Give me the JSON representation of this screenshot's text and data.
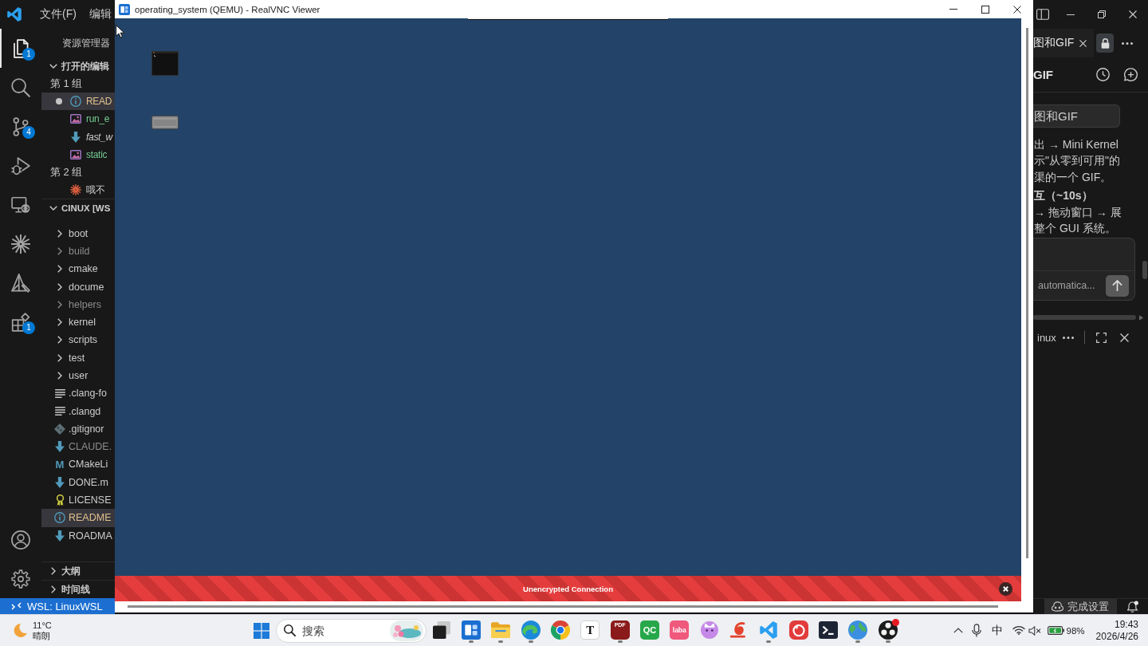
{
  "vscode": {
    "menu": [
      {
        "label": "文件(F)"
      },
      {
        "label": "编辑"
      }
    ],
    "activity_bar": [
      {
        "selected": true,
        "badge": "1"
      },
      {
        "selected": false
      },
      {
        "selected": false,
        "badge": "4"
      },
      {
        "selected": false
      },
      {
        "selected": false
      },
      {
        "selected": false
      },
      {
        "selected": false
      },
      {
        "selected": false,
        "badge": "1"
      }
    ],
    "explorer": {
      "title": "资源管理器",
      "open_editors": {
        "title": "打开的编辑",
        "expanded": true,
        "groups": [
          {
            "label": "第 1 组",
            "items": [
              {
                "label": "READ",
                "kind": "readme",
                "color": "#e2c08d",
                "selected": true,
                "dirty": true,
                "preview": false
              },
              {
                "label": "run_e",
                "kind": "image",
                "color": "#73c991",
                "selected": false,
                "dirty": false,
                "preview": false
              },
              {
                "label": "fast_w",
                "kind": "markdown",
                "color": "#cccccc",
                "selected": false,
                "dirty": false,
                "preview": true
              },
              {
                "label": "static",
                "kind": "image",
                "color": "#73c991",
                "selected": false,
                "dirty": false,
                "preview": false
              }
            ]
          },
          {
            "label": "第 2 组",
            "items": [
              {
                "label": "哦不",
                "kind": "chat",
                "color": "#cccccc",
                "selected": false,
                "dirty": false,
                "preview": false
              }
            ]
          }
        ]
      },
      "workspace": {
        "title": "CINUX [WS",
        "expanded": true,
        "items": [
          {
            "label": "boot",
            "kind": "folder",
            "expanded": false,
            "color": "#cccccc",
            "selected": false
          },
          {
            "label": "build",
            "kind": "folder",
            "expanded": false,
            "color": "#8c8c8c",
            "selected": false
          },
          {
            "label": "cmake",
            "kind": "folder",
            "expanded": false,
            "color": "#cccccc",
            "selected": false
          },
          {
            "label": "docume",
            "kind": "folder",
            "expanded": false,
            "color": "#cccccc",
            "selected": false
          },
          {
            "label": "helpers",
            "kind": "folder",
            "expanded": false,
            "color": "#8c8c8c",
            "selected": false
          },
          {
            "label": "kernel",
            "kind": "folder",
            "expanded": false,
            "color": "#cccccc",
            "selected": false
          },
          {
            "label": "scripts",
            "kind": "folder",
            "expanded": false,
            "color": "#cccccc",
            "selected": false
          },
          {
            "label": "test",
            "kind": "folder",
            "expanded": false,
            "color": "#cccccc",
            "selected": false
          },
          {
            "label": "user",
            "kind": "folder",
            "expanded": false,
            "color": "#cccccc",
            "selected": false
          },
          {
            "label": ".clang-fo",
            "kind": "config",
            "color": "#cccccc",
            "selected": false
          },
          {
            "label": ".clangd",
            "kind": "config",
            "color": "#cccccc",
            "selected": false
          },
          {
            "label": ".gitignor",
            "kind": "git",
            "color": "#cccccc",
            "selected": false
          },
          {
            "label": "CLAUDE.",
            "kind": "markdown",
            "color": "#8c8c8c",
            "selected": false
          },
          {
            "label": "CMakeLi",
            "kind": "cmake",
            "icon_char": "M",
            "color": "#cccccc",
            "selected": false
          },
          {
            "label": "DONE.m",
            "kind": "markdown",
            "color": "#cccccc",
            "selected": false
          },
          {
            "label": "LICENSE",
            "kind": "license",
            "color": "#cccccc",
            "selected": false
          },
          {
            "label": "README",
            "kind": "readme",
            "color": "#e2c08d",
            "selected": true
          },
          {
            "label": "ROADMA",
            "kind": "markdown",
            "color": "#cccccc",
            "selected": false
          }
        ]
      },
      "sections": [
        {
          "title": "大纲",
          "expanded": false
        },
        {
          "title": "时间线",
          "expanded": false
        }
      ]
    },
    "assistant": {
      "tab": {
        "label": "图和GIF",
        "selected": true
      },
      "title": "GIF",
      "user_message": "图和GIF",
      "lines": [
        {
          "text": "出 → Mini Kernel",
          "bold": false
        },
        {
          "text": "示\"从零到可用\"的",
          "bold": false
        },
        {
          "text": "渠的一个 GIF。",
          "bold": false
        },
        {
          "text": "互（~10s）",
          "bold": true
        },
        {
          "text": "→ 拖动窗口 → 展",
          "bold": false
        },
        {
          "text": "整个 GUI 系统。",
          "bold": false
        }
      ],
      "mode": "automatica..."
    },
    "panel": {
      "title": "inux"
    },
    "status_bar": {
      "remote": "WSL: LinuxWSL",
      "setup": "完成设置"
    }
  },
  "vnc": {
    "title": "operating_system (QEMU) - RealVNC Viewer",
    "banner": {
      "text": "Unencrypted Connection"
    }
  },
  "taskbar": {
    "weather": {
      "temperature": "11°C",
      "condition": "晴朗"
    },
    "search": {
      "placeholder": "搜索"
    },
    "apps": [
      {
        "running": false,
        "notification": false
      },
      {
        "running": true,
        "notification": false
      },
      {
        "running": true,
        "notification": false
      },
      {
        "running": true,
        "notification": false
      },
      {
        "running": false,
        "notification": false
      },
      {
        "running": false,
        "notification": false,
        "icon_text": "T"
      },
      {
        "running": true,
        "notification": false,
        "icon_text": "PDF"
      },
      {
        "running": false,
        "notification": false,
        "icon_text": "QC"
      },
      {
        "running": false,
        "notification": false,
        "icon_text": "laba"
      },
      {
        "running": false,
        "notification": false
      },
      {
        "running": false,
        "notification": false
      },
      {
        "running": true,
        "notification": false
      },
      {
        "running": false,
        "notification": false
      },
      {
        "running": false,
        "notification": false
      },
      {
        "running": true,
        "notification": false
      },
      {
        "running": true,
        "notification": true
      }
    ],
    "tray": {
      "input_method": "中",
      "battery": "98%",
      "time": "19:43",
      "date": "2026/4/26"
    }
  }
}
